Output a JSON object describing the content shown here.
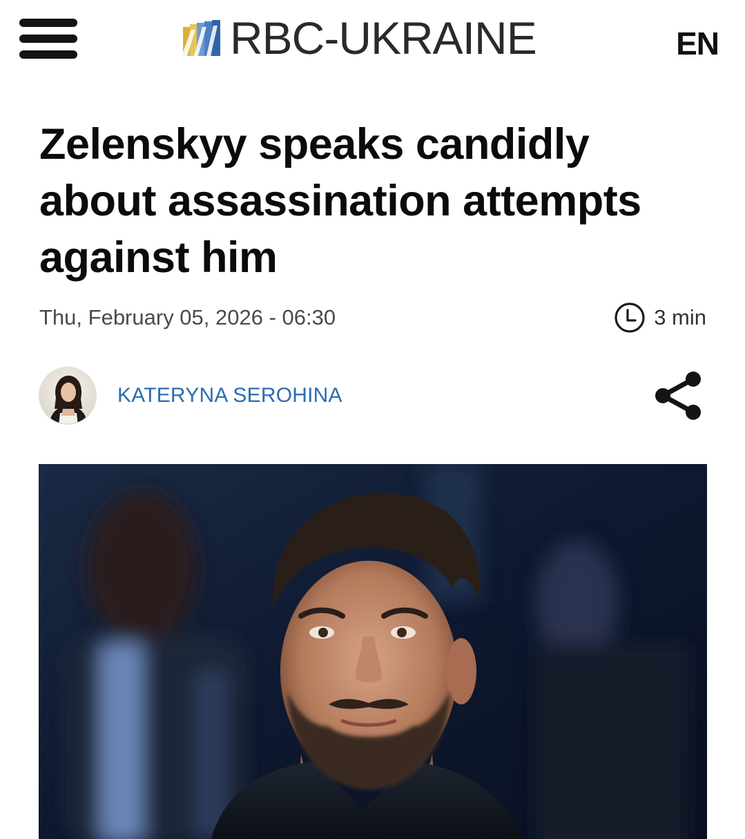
{
  "header": {
    "menu_icon": "hamburger-menu-icon",
    "logo_text": "RBC-UKRAINE",
    "language": "EN"
  },
  "article": {
    "headline": "Zelenskyy speaks candidly about assassination attempts against him",
    "date": "Thu, February 05, 2026 - 06:30",
    "read_time": "3 min",
    "author": "KATERYNA SEROHINA"
  },
  "colors": {
    "author_link": "#2b6cb0",
    "text": "#0b0b0b",
    "meta": "#4a4a4a",
    "logo_gold": "#d9b23c",
    "logo_blue": "#4a7fc0"
  },
  "icons": {
    "clock": "clock-icon",
    "share": "share-icon"
  }
}
